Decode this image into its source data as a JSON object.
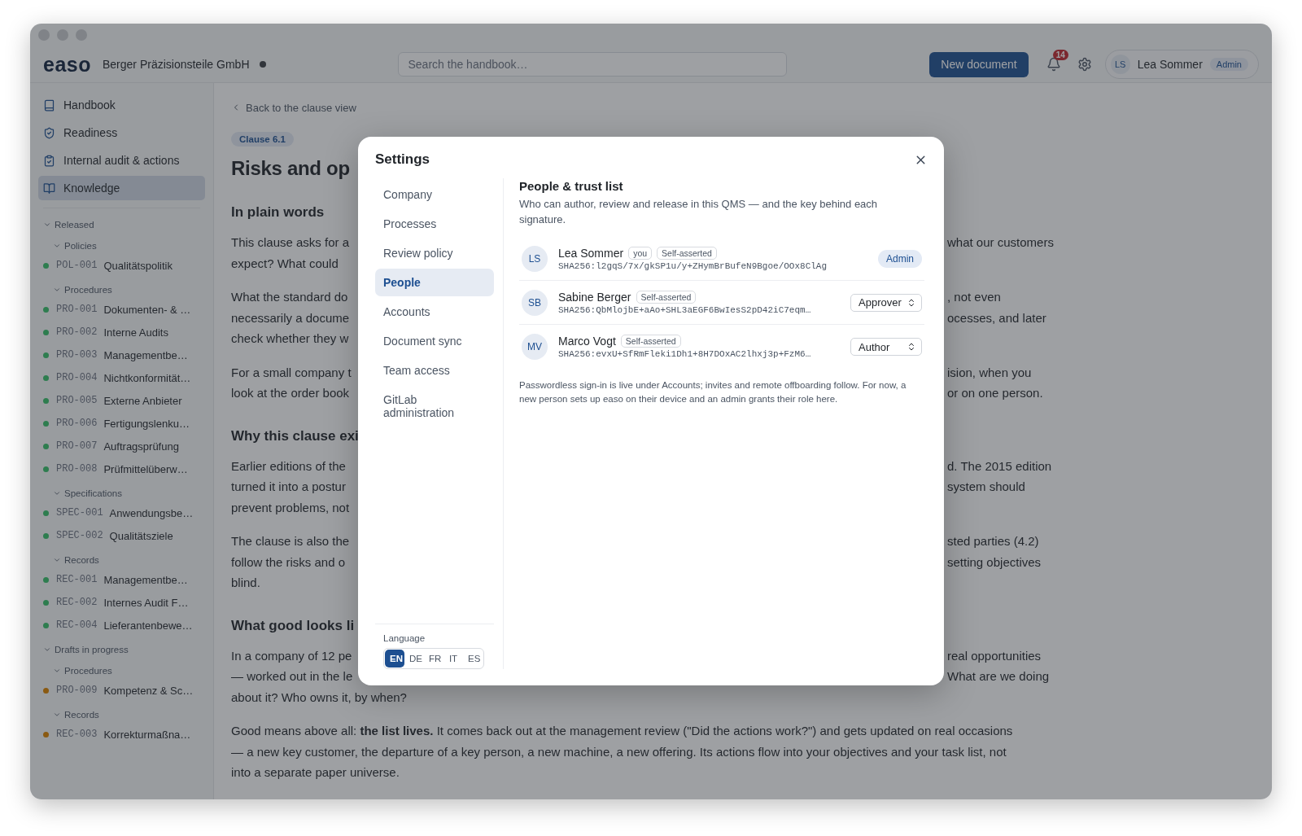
{
  "topbar": {
    "logo": "easo",
    "company": "Berger Präzisionsteile GmbH",
    "search": {
      "placeholder": "Search the handbook…"
    },
    "new_button": "New document",
    "notifications": {
      "count": "14"
    },
    "user": {
      "initials": "LS",
      "name": "Lea Sommer",
      "role": "Admin"
    }
  },
  "sidebar": {
    "nav": [
      {
        "label": "Handbook",
        "selected": false
      },
      {
        "label": "Readiness",
        "selected": false
      },
      {
        "label": "Internal audit & actions",
        "selected": false
      },
      {
        "label": "Knowledge",
        "selected": true
      }
    ],
    "tree": [
      {
        "kind": "group",
        "label": "Released",
        "expanded": true,
        "children": [
          {
            "kind": "group",
            "label": "Policies",
            "expanded": true,
            "children": [
              {
                "kind": "doc",
                "code": "POL-001",
                "title": "Qualitätspolitik",
                "color": "#2e7d4f"
              }
            ]
          },
          {
            "kind": "group",
            "label": "Procedures",
            "expanded": true,
            "children": [
              {
                "kind": "doc",
                "code": "PRO-001",
                "title": "Dokumenten- & …",
                "color": "#2e7d4f"
              },
              {
                "kind": "doc",
                "code": "PRO-002",
                "title": "Interne Audits",
                "color": "#2e7d4f"
              },
              {
                "kind": "doc",
                "code": "PRO-003",
                "title": "Managementbe…",
                "color": "#2e7d4f"
              },
              {
                "kind": "doc",
                "code": "PRO-004",
                "title": "Nichtkonformität…",
                "color": "#2e7d4f"
              },
              {
                "kind": "doc",
                "code": "PRO-005",
                "title": "Externe Anbieter",
                "color": "#2e7d4f"
              },
              {
                "kind": "doc",
                "code": "PRO-006",
                "title": "Fertigungslenku…",
                "color": "#2e7d4f"
              },
              {
                "kind": "doc",
                "code": "PRO-007",
                "title": "Auftragsprüfung",
                "color": "#2e7d4f"
              },
              {
                "kind": "doc",
                "code": "PRO-008",
                "title": "Prüfmittelüberw…",
                "color": "#2e7d4f"
              }
            ]
          },
          {
            "kind": "group",
            "label": "Specifications",
            "expanded": true,
            "children": [
              {
                "kind": "doc",
                "code": "SPEC-001",
                "title": "Anwendungsbe…",
                "color": "#2e7d4f"
              },
              {
                "kind": "doc",
                "code": "SPEC-002",
                "title": "Qualitätsziele",
                "color": "#2e7d4f"
              }
            ]
          },
          {
            "kind": "group",
            "label": "Records",
            "expanded": true,
            "children": [
              {
                "kind": "doc",
                "code": "REC-001",
                "title": "Managementbe…",
                "color": "#2e7d4f"
              },
              {
                "kind": "doc",
                "code": "REC-002",
                "title": "Internes Audit F…",
                "color": "#2e7d4f"
              },
              {
                "kind": "doc",
                "code": "REC-004",
                "title": "Lieferantenbewe…",
                "color": "#2e7d4f"
              }
            ]
          }
        ]
      },
      {
        "kind": "group",
        "label": "Drafts in progress",
        "expanded": true,
        "children": [
          {
            "kind": "group",
            "label": "Procedures",
            "expanded": true,
            "children": [
              {
                "kind": "doc",
                "code": "PRO-009",
                "title": "Kompetenz & Sc…",
                "color": "#8a5a12"
              }
            ]
          },
          {
            "kind": "group",
            "label": "Records",
            "expanded": true,
            "children": [
              {
                "kind": "doc",
                "code": "REC-003",
                "title": "Korrekturmaßna…",
                "color": "#8a5a12"
              }
            ]
          }
        ]
      }
    ]
  },
  "content": {
    "back_link": "Back to the clause view",
    "clause_badge": "Clause 6.1",
    "title": "Risks and op",
    "sections": [
      {
        "heading": "In plain words",
        "paragraphs": [
          [
            {
              "left": "This clause asks for a",
              "right": "what our customers"
            },
            {
              "left": "expect? What could"
            }
          ],
          [
            {
              "left": "What the standard do",
              "right": ", not even"
            },
            {
              "left": "necessarily a docume",
              "right": "ocesses, and later"
            },
            {
              "left": "check whether they w"
            }
          ],
          [
            {
              "left": "For a small company t",
              "right": "ision, when you"
            },
            {
              "left": "look at the order book",
              "right": "or on one person."
            }
          ]
        ]
      },
      {
        "heading": "Why this clause exi",
        "paragraphs": [
          [
            {
              "left": "Earlier editions of the",
              "right": "d. The 2015 edition"
            },
            {
              "left": "turned it into a postur",
              "right": "system should"
            },
            {
              "left": "prevent problems, not"
            }
          ],
          [
            {
              "left": "The clause is also the",
              "right": "sted parties (4.2)"
            },
            {
              "left": "follow the risks and o",
              "right": "setting objectives"
            },
            {
              "left": "blind."
            }
          ]
        ]
      },
      {
        "heading": "What good looks li",
        "paragraphs": [
          [
            {
              "left": "In a company of 12 pe",
              "right": "real opportunities"
            },
            {
              "left": "— worked out in the le",
              "right": "What are we doing"
            },
            {
              "left": "about it? Who owns it, by when?"
            }
          ],
          [
            {
              "left": "Good means above all: **the list lives.** It comes back out at the management review (\"Did the actions work?\") and gets updated on real occasions"
            },
            {
              "left": "— a new key customer, the departure of a key person, a new machine, a new offering. Its actions flow into your objectives and your task list, not"
            },
            {
              "left": "into a separate paper universe."
            }
          ]
        ]
      }
    ]
  },
  "modal": {
    "title": "Settings",
    "nav": [
      {
        "label": "Company",
        "selected": false
      },
      {
        "label": "Processes",
        "selected": false
      },
      {
        "label": "Review policy",
        "selected": false
      },
      {
        "label": "People",
        "selected": true
      },
      {
        "label": "Accounts",
        "selected": false
      },
      {
        "label": "Document sync",
        "selected": false
      },
      {
        "label": "Team access",
        "selected": false
      },
      {
        "label": "GitLab administration",
        "selected": false
      }
    ],
    "language": {
      "label": "Language",
      "options": [
        {
          "label": "EN",
          "selected": true
        },
        {
          "label": "DE",
          "selected": false
        },
        {
          "label": "FR",
          "selected": false
        },
        {
          "label": "IT",
          "selected": false
        },
        {
          "label": "ES",
          "selected": false
        }
      ]
    },
    "panel": {
      "heading": "People & trust list",
      "description": "Who can author, review and release in this QMS — and the key behind each signature.",
      "people": [
        {
          "initials": "LS",
          "name": "Lea Sommer",
          "tag": "you",
          "trust": "Self-asserted",
          "key": "SHA256:l2gqS/7x/gkSP1u/y+ZHymBrBufeN9Bgoe/OOx8ClAg",
          "role": {
            "kind": "badge",
            "label": "Admin"
          }
        },
        {
          "initials": "SB",
          "name": "Sabine Berger",
          "trust": "Self-asserted",
          "key": "SHA256:QbMlojbE+aAo+SHL3aEGF6BwIesS2pD42iC7eqm…",
          "role": {
            "kind": "select",
            "label": "Approver"
          }
        },
        {
          "initials": "MV",
          "name": "Marco Vogt",
          "trust": "Self-asserted",
          "key": "SHA256:evxU+SfRmFleki1Dh1+8H7DOxAC2lhxj3p+FzM6…",
          "role": {
            "kind": "select",
            "label": "Author"
          }
        }
      ],
      "note": "Passwordless sign-in is live under Accounts; invites and remote offboarding follow. For now, a new person sets up easo on their device and an admin grants their role here."
    }
  }
}
